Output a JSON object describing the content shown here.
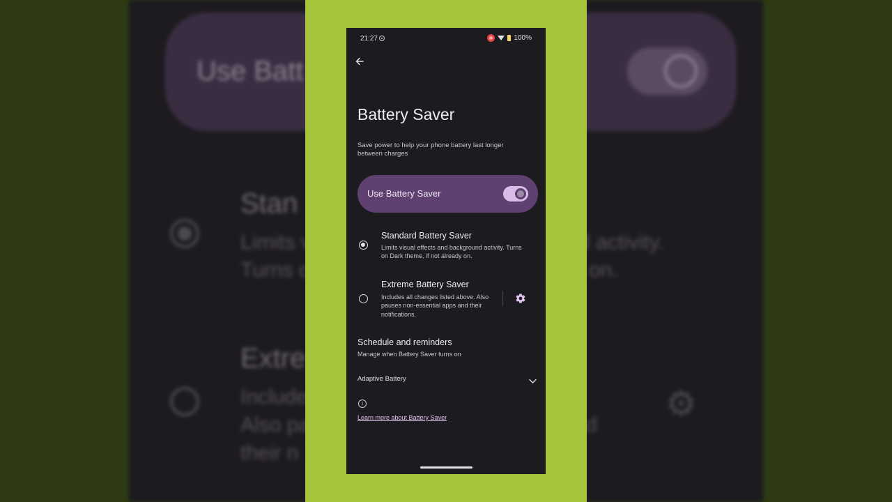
{
  "status_bar": {
    "time": "21:27",
    "battery": "100%"
  },
  "page": {
    "title": "Battery Saver",
    "description": "Save power to help your phone battery last longer between charges"
  },
  "main_toggle": {
    "label": "Use Battery Saver",
    "enabled": true
  },
  "options": {
    "standard": {
      "title": "Standard Battery Saver",
      "description": "Limits visual effects and background activity. Turns on Dark theme, if not already on.",
      "selected": true
    },
    "extreme": {
      "title": "Extreme Battery Saver",
      "description": "Includes all changes listed above. Also pauses non-essential apps and their notifications.",
      "selected": false
    }
  },
  "schedule": {
    "title": "Schedule and reminders",
    "description": "Manage when Battery Saver turns on"
  },
  "adaptive": {
    "label": "Adaptive Battery"
  },
  "footer": {
    "link": "Learn more about Battery Saver"
  },
  "background_zoom": {
    "toggle_label": "Use Batt",
    "standard_title": "Stan",
    "standard_line1_left": "Limits v",
    "standard_line1_right": "d activity.",
    "standard_line2_left": "Turns o",
    "standard_line2_right": "on.",
    "extreme_title": "Extre",
    "extreme_line1": "Include",
    "extreme_line2_left": "Also pa",
    "extreme_line2_right": "d",
    "extreme_line3": "their n"
  },
  "colors": {
    "frame": "#a7c53c",
    "screen_bg": "#1c1b1f",
    "toggle_card": "#5e4170",
    "switch_track": "#d9bde8",
    "link": "#e0c4f0"
  }
}
